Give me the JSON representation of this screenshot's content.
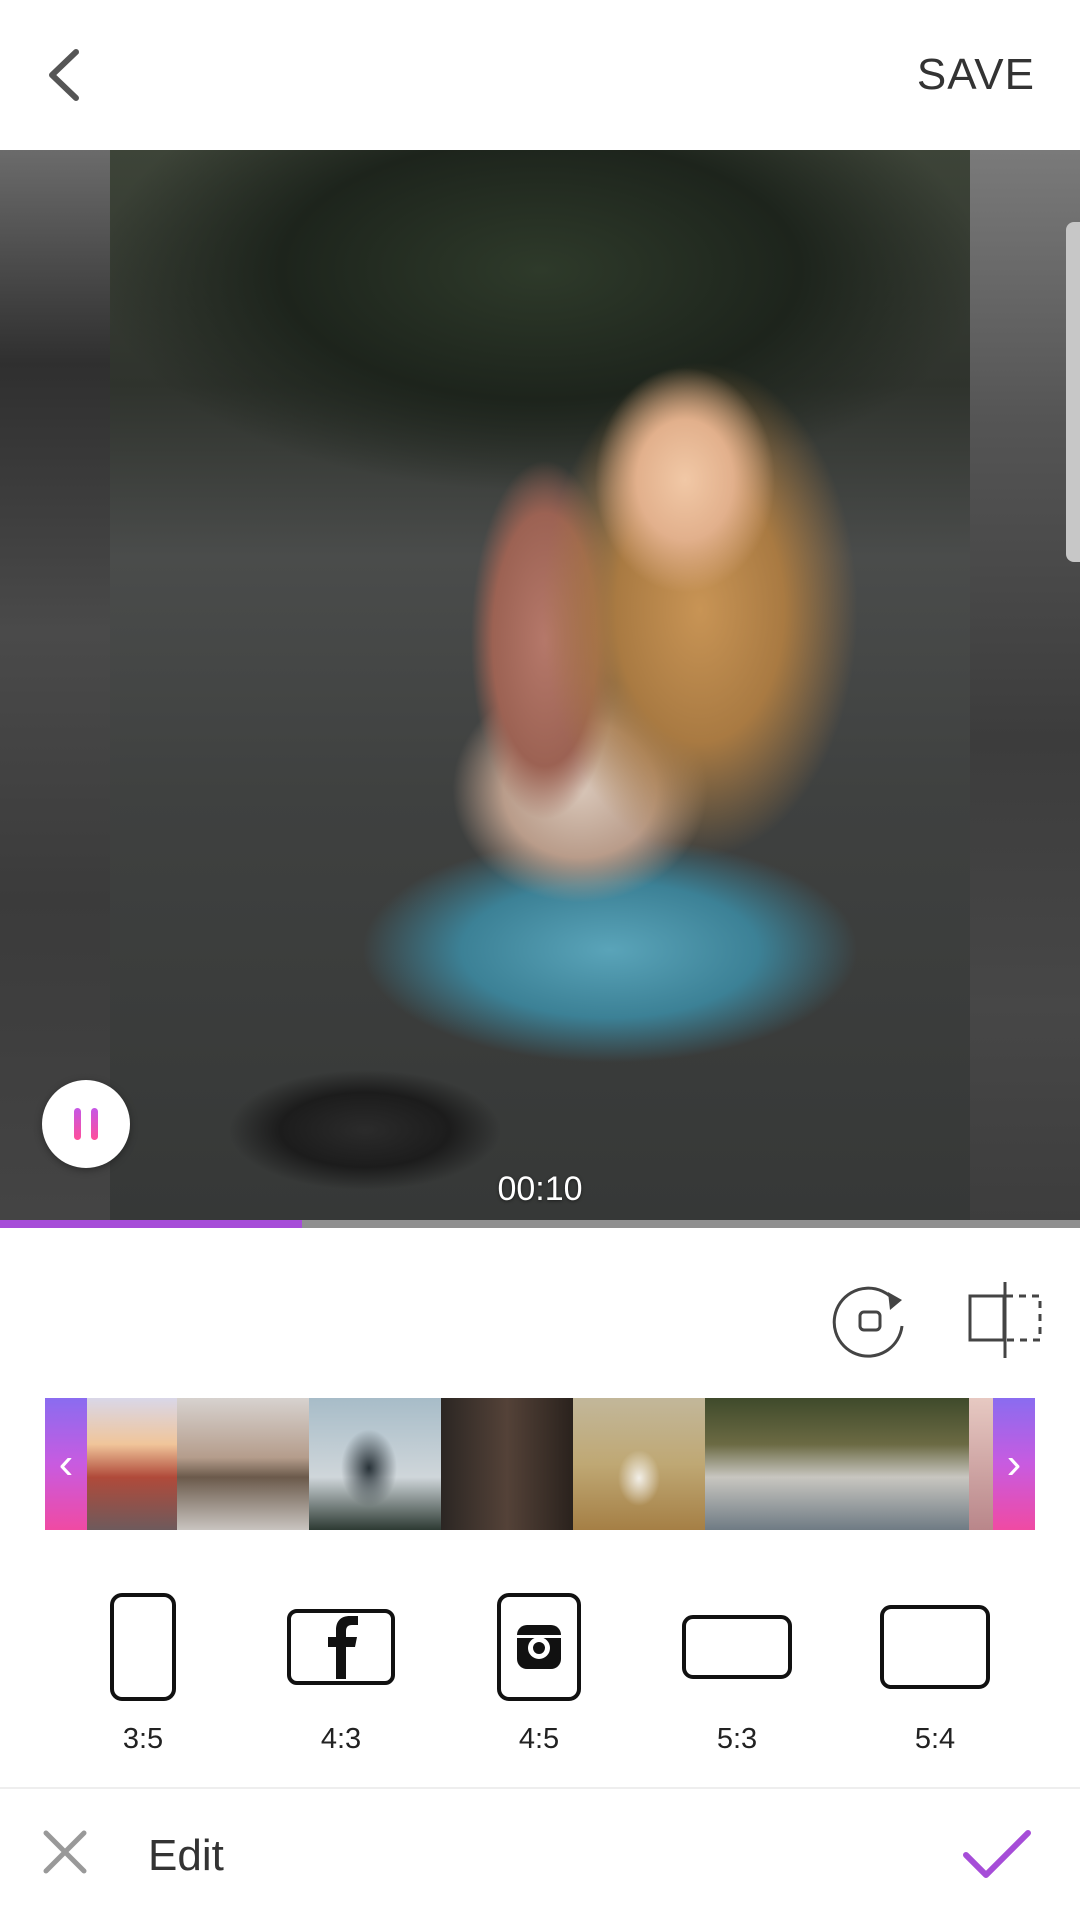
{
  "header": {
    "back_icon": "chevron-left-icon",
    "save_label": "SAVE"
  },
  "preview": {
    "time": "00:10",
    "progress_fraction": 0.28,
    "pause_icon": "pause-icon",
    "accent_color": "#a64dd8"
  },
  "tools": {
    "rotate_icon": "rotate-icon",
    "mirror_icon": "mirror-split-icon"
  },
  "strip": {
    "prev_icon": "chevron-left-icon",
    "next_icon": "chevron-right-icon",
    "thumbnails": [
      "street-sunset",
      "girl-sitting-courtyard",
      "girl-camera",
      "girl-dark-wall",
      "girl-wheat-field",
      "lighthouse-1",
      "lighthouse-2",
      "partial"
    ]
  },
  "ratios": [
    {
      "label": "3:5",
      "icon": "portrait-frame-icon"
    },
    {
      "label": "4:3",
      "icon": "facebook-frame-icon"
    },
    {
      "label": "4:5",
      "icon": "instagram-frame-icon"
    },
    {
      "label": "5:3",
      "icon": "landscape-frame-icon"
    },
    {
      "label": "5:4",
      "icon": "landscape-frame-icon"
    }
  ],
  "footer": {
    "close_icon": "close-icon",
    "title": "Edit",
    "confirm_icon": "check-icon",
    "confirm_color": "#a64dd8"
  }
}
